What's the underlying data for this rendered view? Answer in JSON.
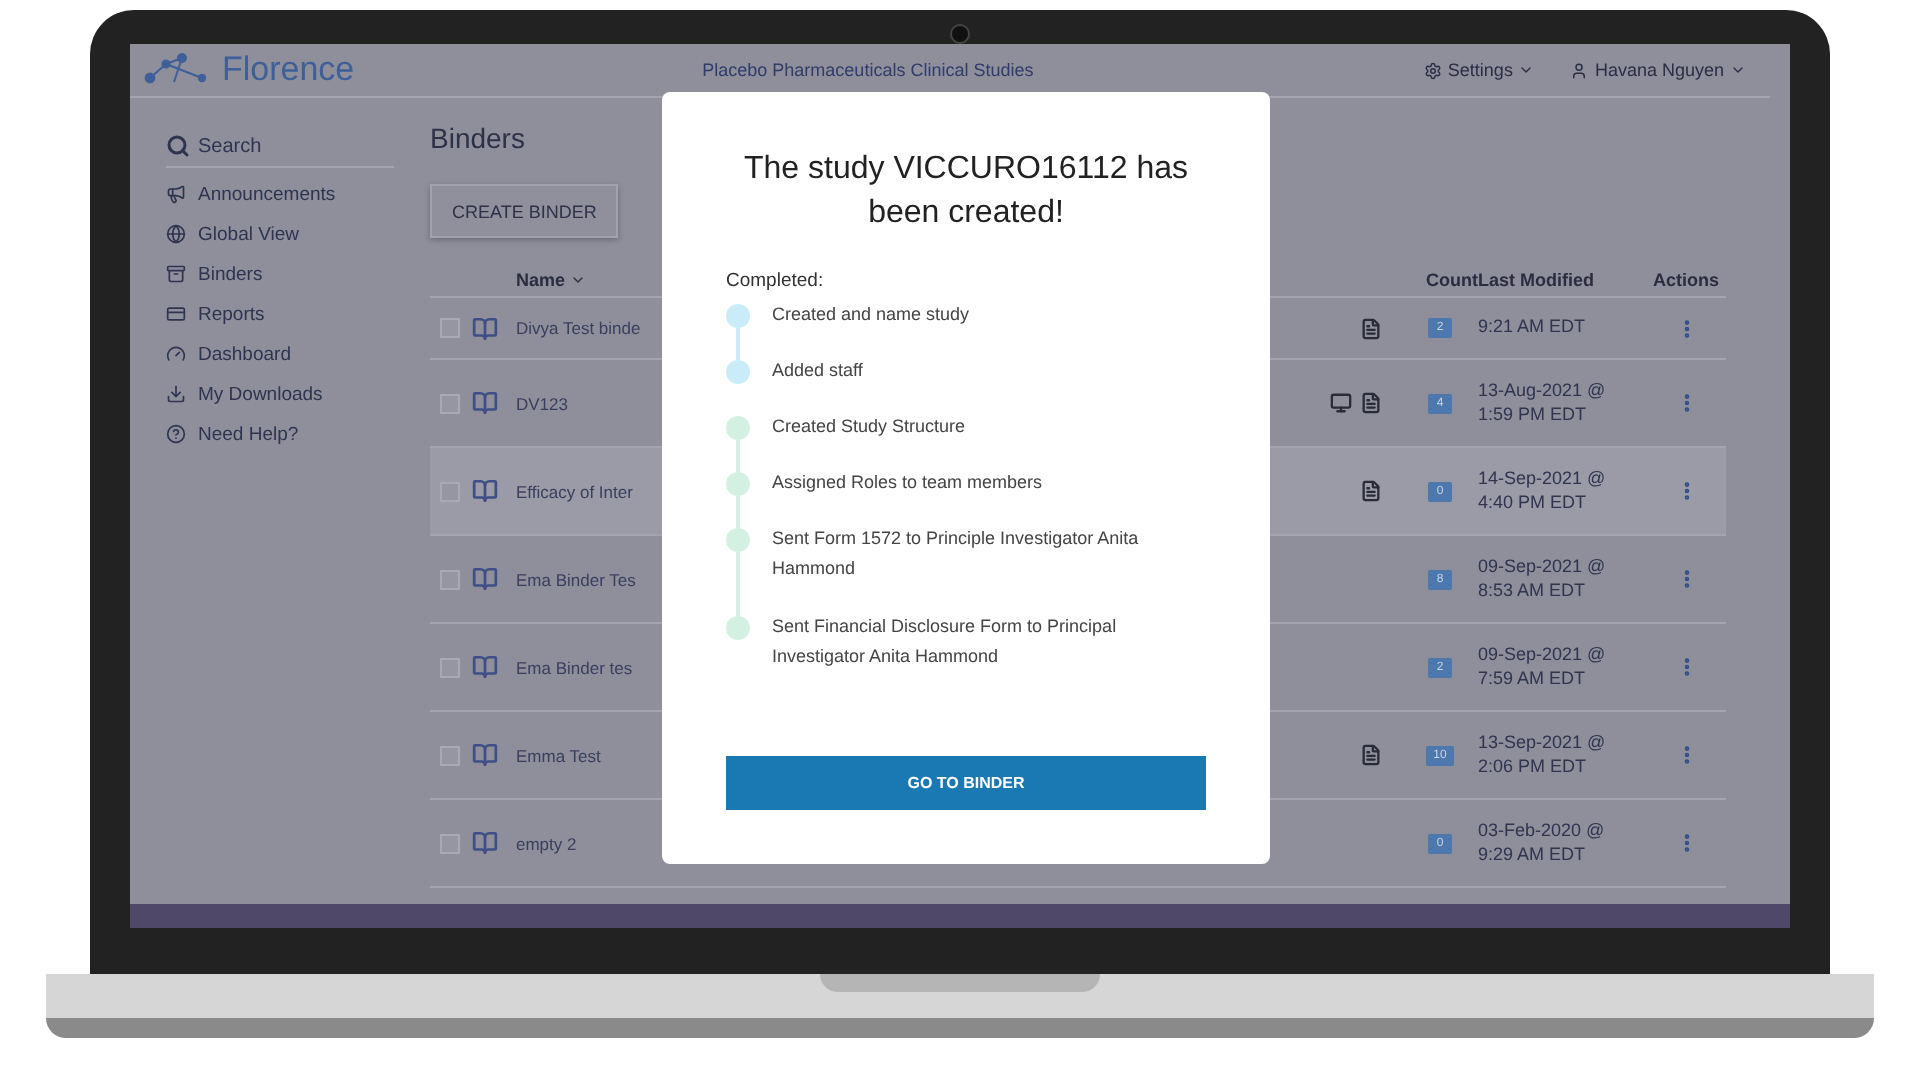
{
  "header": {
    "logo": "Florence",
    "title": "Placebo Pharmaceuticals Clinical Studies",
    "settings": "Settings",
    "user": "Havana Nguyen"
  },
  "sidebar": {
    "search": "Search",
    "items": [
      {
        "label": "Announcements"
      },
      {
        "label": "Global View"
      },
      {
        "label": "Binders"
      },
      {
        "label": "Reports"
      },
      {
        "label": "Dashboard"
      },
      {
        "label": "My Downloads"
      },
      {
        "label": "Need Help?"
      }
    ]
  },
  "main": {
    "title": "Binders",
    "create_button": "CREATE BINDER",
    "table": {
      "columns": [
        "Name",
        "Count",
        "Last Modified",
        "Actions"
      ],
      "rows": [
        {
          "name": "Divya Test binde",
          "monitor": false,
          "report": true,
          "count": "2",
          "date": "9:21 AM EDT",
          "time": "",
          "selected": false
        },
        {
          "name": "DV123",
          "monitor": true,
          "report": true,
          "count": "4",
          "date": "13-Aug-2021 @",
          "time": "1:59 PM EDT",
          "selected": false
        },
        {
          "name": "Efficacy of Inter",
          "monitor": false,
          "report": true,
          "count": "0",
          "date": "14-Sep-2021 @",
          "time": "4:40 PM EDT",
          "selected": true
        },
        {
          "name": "Ema Binder Tes",
          "monitor": false,
          "report": false,
          "count": "8",
          "date": "09-Sep-2021 @",
          "time": "8:53 AM EDT",
          "selected": false
        },
        {
          "name": "Ema Binder tes",
          "monitor": false,
          "report": false,
          "count": "2",
          "date": "09-Sep-2021 @",
          "time": "7:59 AM EDT",
          "selected": false
        },
        {
          "name": "Emma Test",
          "monitor": false,
          "report": true,
          "count": "10",
          "date": "13-Sep-2021 @",
          "time": "2:06 PM EDT",
          "selected": false
        },
        {
          "name": "empty 2",
          "monitor": false,
          "report": false,
          "count": "0",
          "date": "03-Feb-2020 @",
          "time": "9:29 AM EDT",
          "selected": false
        }
      ]
    }
  },
  "modal": {
    "title": "The study VICCURO16112 has been created!",
    "subtitle": "Completed:",
    "steps": [
      {
        "text": "Created and name study",
        "color": "#c9ecf8"
      },
      {
        "text": "Added staff",
        "color": "#c9ecf8"
      },
      {
        "text": "Created Study Structure",
        "color": "#d3f1e3"
      },
      {
        "text": "Assigned Roles to team members",
        "color": "#d3f1e3"
      },
      {
        "text": "Sent Form 1572 to Principle Investigator Anita Hammond",
        "color": "#d3f1e3"
      },
      {
        "text": "Sent Financial Disclosure Form to Principal Investigator Anita Hammond",
        "color": "#d3f1e3"
      }
    ],
    "button": "GO TO BINDER"
  }
}
